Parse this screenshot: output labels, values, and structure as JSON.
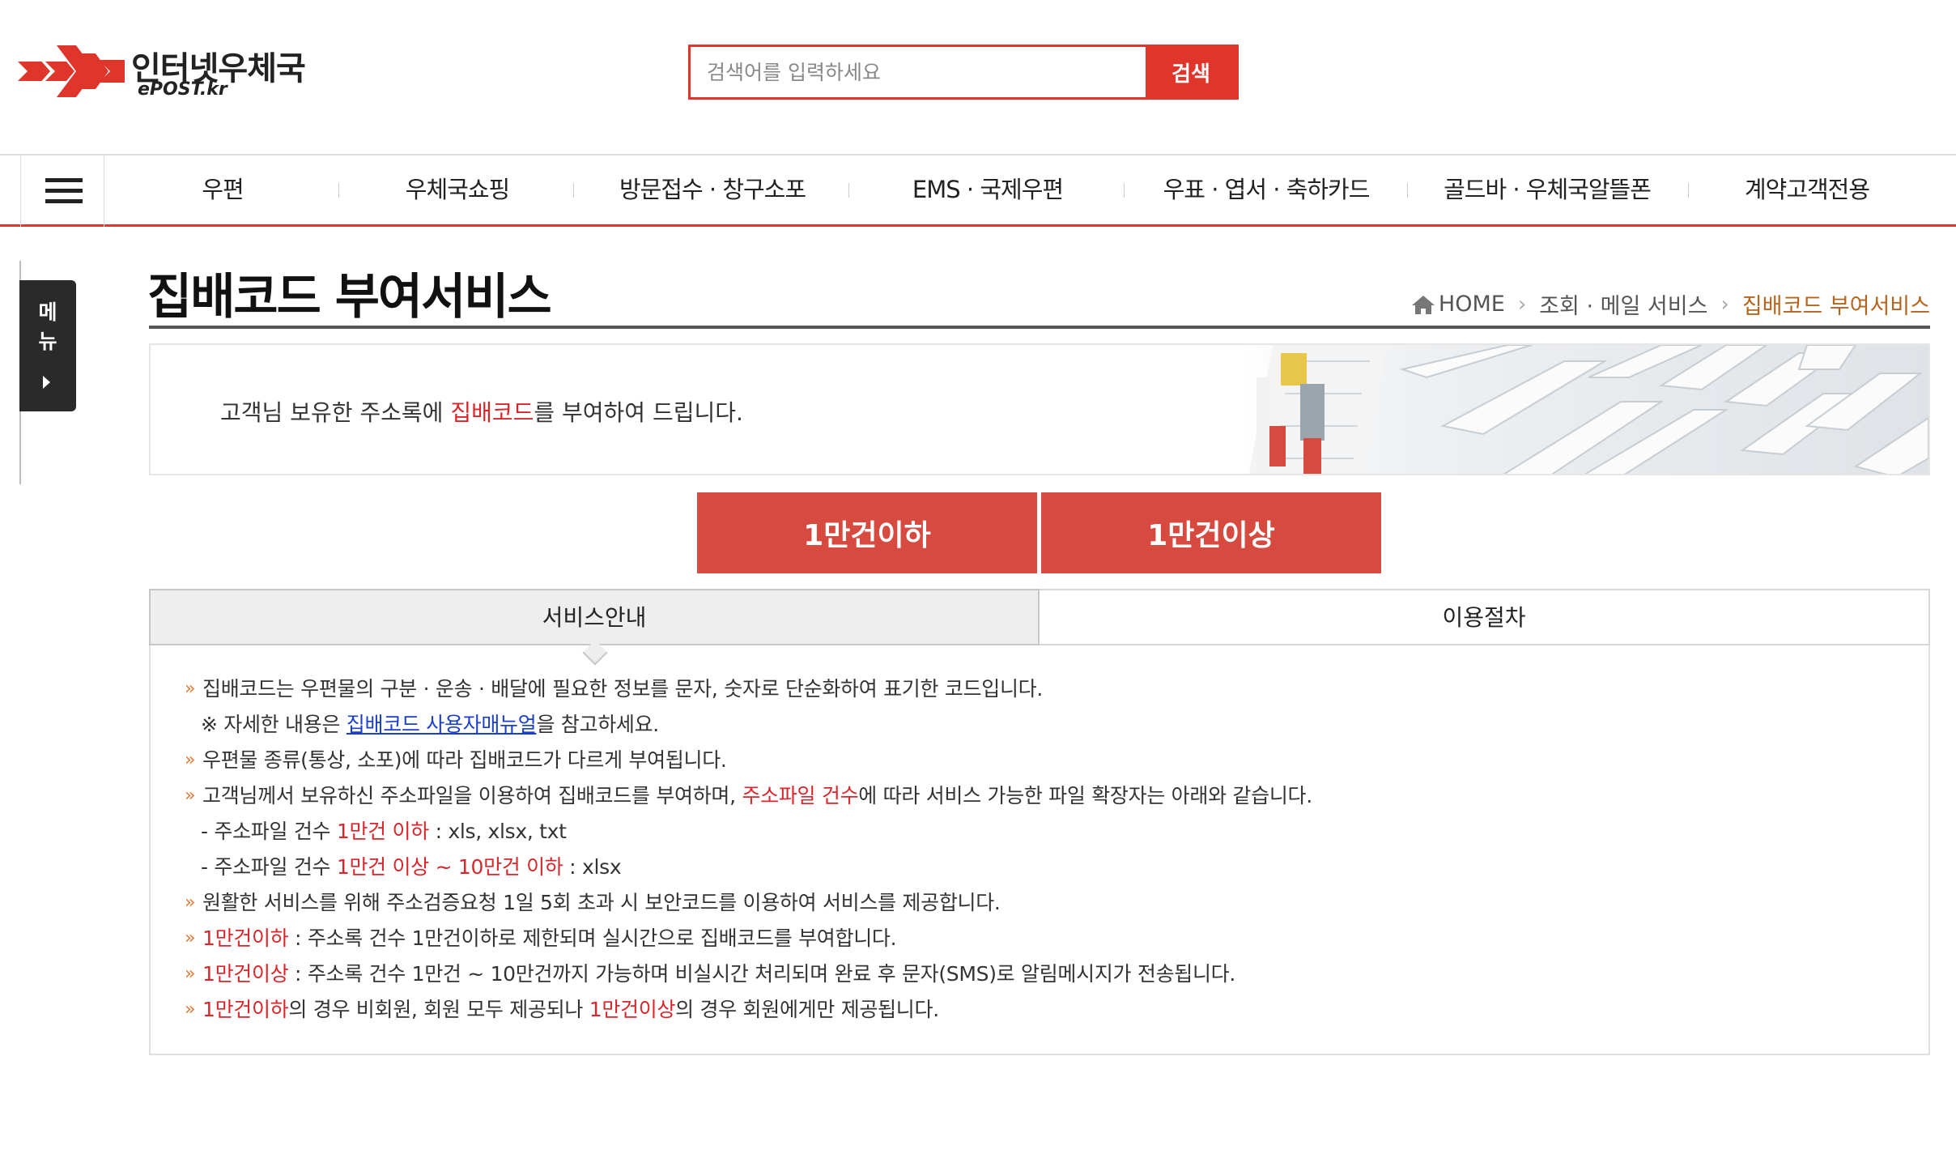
{
  "header": {
    "logo_kr": "인터넷우체국",
    "logo_en": "ePOST.kr",
    "search_placeholder": "검색어를 입력하세요",
    "search_button": "검색"
  },
  "gnb": {
    "items": [
      "우편",
      "우체국쇼핑",
      "방문접수 · 창구소포",
      "EMS · 국제우편",
      "우표 · 엽서 · 축하카드",
      "골드바 · 우체국알뜰폰",
      "계약고객전용"
    ]
  },
  "side_tab": {
    "label": "메\n뉴"
  },
  "page": {
    "title": "집배코드 부여서비스",
    "breadcrumb": [
      "HOME",
      "조회 · 메일 서비스",
      "집배코드 부여서비스"
    ]
  },
  "banner": {
    "text_before": "고객님 보유한 주소록에 ",
    "text_highlight": "집배코드",
    "text_after": "를 부여하여 드립니다."
  },
  "buttons": {
    "under": "1만건이하",
    "over": "1만건이상"
  },
  "tabs": {
    "active": "서비스안내",
    "other": "이용절차"
  },
  "content": {
    "l1": "집배코드는 우편물의 구분 · 운송 · 배달에 필요한 정보를 문자, 숫자로 단순화하여 표기한 코드입니다.",
    "l2_before": "※ 자세한 내용은 ",
    "l2_link": "집배코드 사용자매뉴얼",
    "l2_after": "을 참고하세요.",
    "l3": "우편물 종류(통상, 소포)에 따라 집배코드가 다르게 부여됩니다.",
    "l4_before": "고객님께서 보유하신 주소파일을 이용하여 집배코드를 부여하며, ",
    "l4_red": "주소파일 건수",
    "l4_after": "에 따라 서비스 가능한 파일 확장자는 아래와 같습니다.",
    "l5_before": "- 주소파일 건수 ",
    "l5_red": "1만건 이하",
    "l5_after": " : xls, xlsx, txt",
    "l6_before": "- 주소파일 건수 ",
    "l6_red": "1만건 이상 ~ 10만건 이하",
    "l6_after": " : xlsx",
    "l7": "원활한 서비스를 위해 주소검증요청 1일 5회 초과 시 보안코드를 이용하여 서비스를 제공합니다.",
    "l8_red": "1만건이하",
    "l8_after": " : 주소록 건수 1만건이하로 제한되며 실시간으로 집배코드를 부여합니다.",
    "l9_red": "1만건이상",
    "l9_after": " : 주소록 건수 1만건 ~ 10만건까지 가능하며 비실시간 처리되며 완료 후 문자(SMS)로 알림메시지가 전송됩니다.",
    "l10_red1": "1만건이하",
    "l10_mid": "의 경우 비회원, 회원 모두 제공되나 ",
    "l10_red2": "1만건이상",
    "l10_after": "의 경우 회원에게만 제공됩니다."
  },
  "colors": {
    "brand_red": "#e0352b",
    "button_red": "#d64a3f",
    "highlight_red": "#d8262a",
    "breadcrumb_current": "#b5651d",
    "link_blue": "#1a3fcc"
  }
}
